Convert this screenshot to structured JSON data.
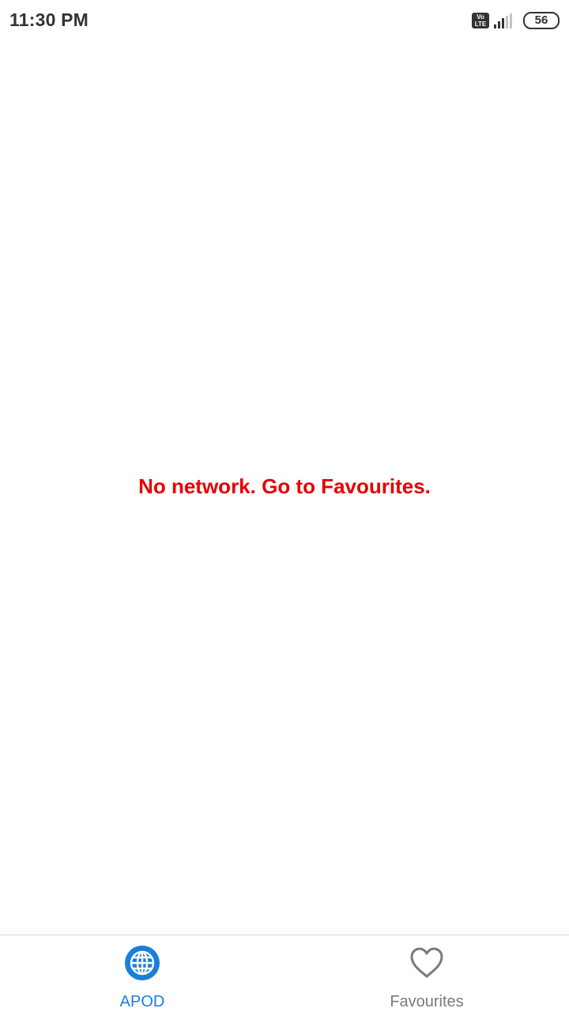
{
  "status_bar": {
    "time": "11:30 PM",
    "volte_top": "Vo",
    "volte_bottom": "LTE",
    "battery": "56",
    "icons": [
      "volte-icon",
      "signal-icon",
      "battery-icon"
    ]
  },
  "main": {
    "message": "No network. Go to Favourites.",
    "message_color": "#e60000"
  },
  "bottom_nav": {
    "items": [
      {
        "label": "APOD",
        "icon": "globe-icon",
        "active": true
      },
      {
        "label": "Favourites",
        "icon": "heart-icon",
        "active": false
      }
    ],
    "active_color": "#1a7fd9",
    "inactive_color": "#7a7a7a"
  }
}
